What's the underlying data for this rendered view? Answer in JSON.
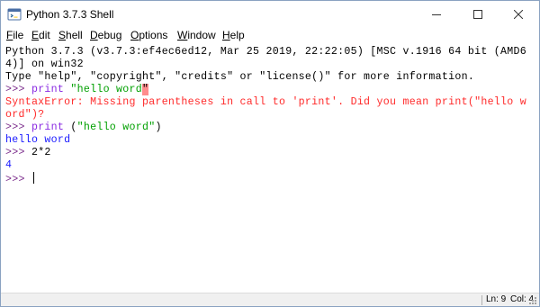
{
  "window": {
    "title": "Python 3.7.3 Shell"
  },
  "menu": {
    "file": "File",
    "edit": "Edit",
    "shell": "Shell",
    "debug": "Debug",
    "options": "Options",
    "window": "Window",
    "help": "Help"
  },
  "shell": {
    "banner_line1": "Python 3.7.3 (v3.7.3:ef4ec6ed12, Mar 25 2019, 22:22:05) [MSC v.1916 64 bit (AMD6",
    "banner_line2": "4)] on win32",
    "banner_line3": "Type \"help\", \"copyright\", \"credits\" or \"license()\" for more information.",
    "prompt": ">>> ",
    "cmd1_keyword": "print",
    "cmd1_space": " ",
    "cmd1_string": "\"hello word",
    "cmd1_highlight": "\"",
    "error_line1": "SyntaxError: Missing parentheses in call to 'print'. Did you mean print(\"hello w",
    "error_line2": "ord\")?",
    "cmd2_keyword": "print",
    "cmd2_open": " (",
    "cmd2_string": "\"hello word\"",
    "cmd2_close": ")",
    "output1": "hello word",
    "cmd3": "2*2",
    "output2": "4"
  },
  "status": {
    "line": "Ln: 9",
    "col": "Col: 4"
  },
  "colors": {
    "prompt": "#7a2a8a",
    "keyword": "#8a2be2",
    "string": "#00a000",
    "error": "#ff2a2a",
    "output": "#1a1aff",
    "highlight": "#ff8c8c"
  },
  "icons": {
    "app": "python-idle-icon",
    "minimize": "minimize-icon",
    "maximize": "maximize-icon",
    "close": "close-icon",
    "resize": "resize-grip-icon"
  }
}
